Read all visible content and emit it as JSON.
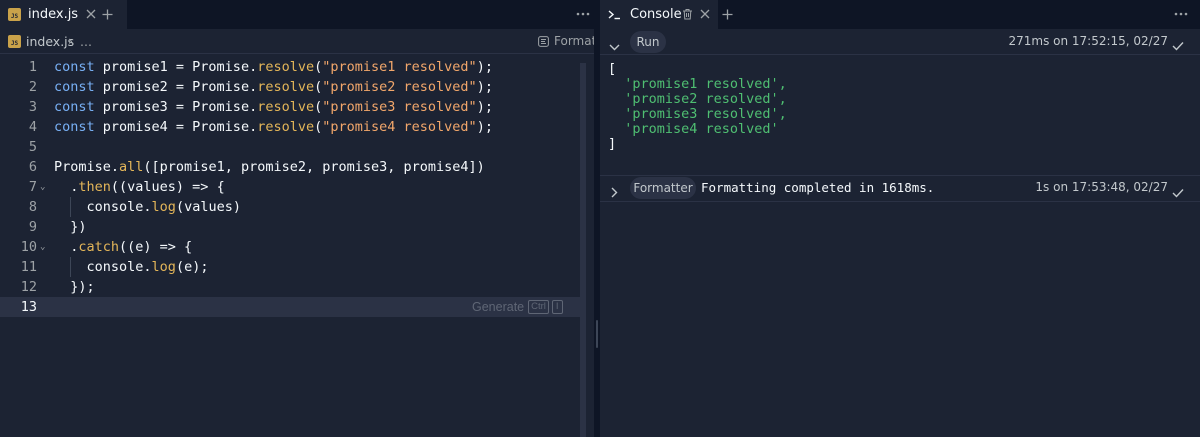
{
  "editor": {
    "tab_title": "index.js",
    "file_icon_text": "JS",
    "breadcrumb_file": "index.js",
    "breadcrumb_sep": "›",
    "breadcrumb_more": "...",
    "format_label": "Format",
    "generate_label": "Generate",
    "kbd_ctrl": "Ctrl",
    "kbd_i": "I",
    "line_numbers": [
      "1",
      "2",
      "3",
      "4",
      "5",
      "6",
      "7",
      "8",
      "9",
      "10",
      "11",
      "12",
      "13"
    ],
    "active_line": 13
  },
  "console": {
    "tab_title": "Console",
    "run_label": "Run",
    "run_meta": "271ms on 17:52:15, 02/27",
    "output": [
      "[",
      "  'promise1 resolved',",
      "  'promise2 resolved',",
      "  'promise3 resolved',",
      "  'promise4 resolved'",
      "]"
    ],
    "formatter_label": "Formatter",
    "formatter_message": "Formatting completed in 1618ms.",
    "formatter_meta": "1s on 17:53:48, 02/27"
  },
  "icons": {
    "close": "close-icon",
    "plus": "plus-icon",
    "menu": "more-icon",
    "trash": "trash-icon",
    "check": "check-icon",
    "chevron_down": "chevron-down-icon",
    "chevron_right": "chevron-right-icon",
    "terminal": "terminal-icon",
    "format": "format-icon"
  },
  "colors": {
    "background": "#1c2333",
    "chrome": "#0e1525",
    "keyword": "#78b0f5",
    "function": "#e4b659",
    "string": "#f2a76b",
    "console_string": "#4fbf72"
  }
}
